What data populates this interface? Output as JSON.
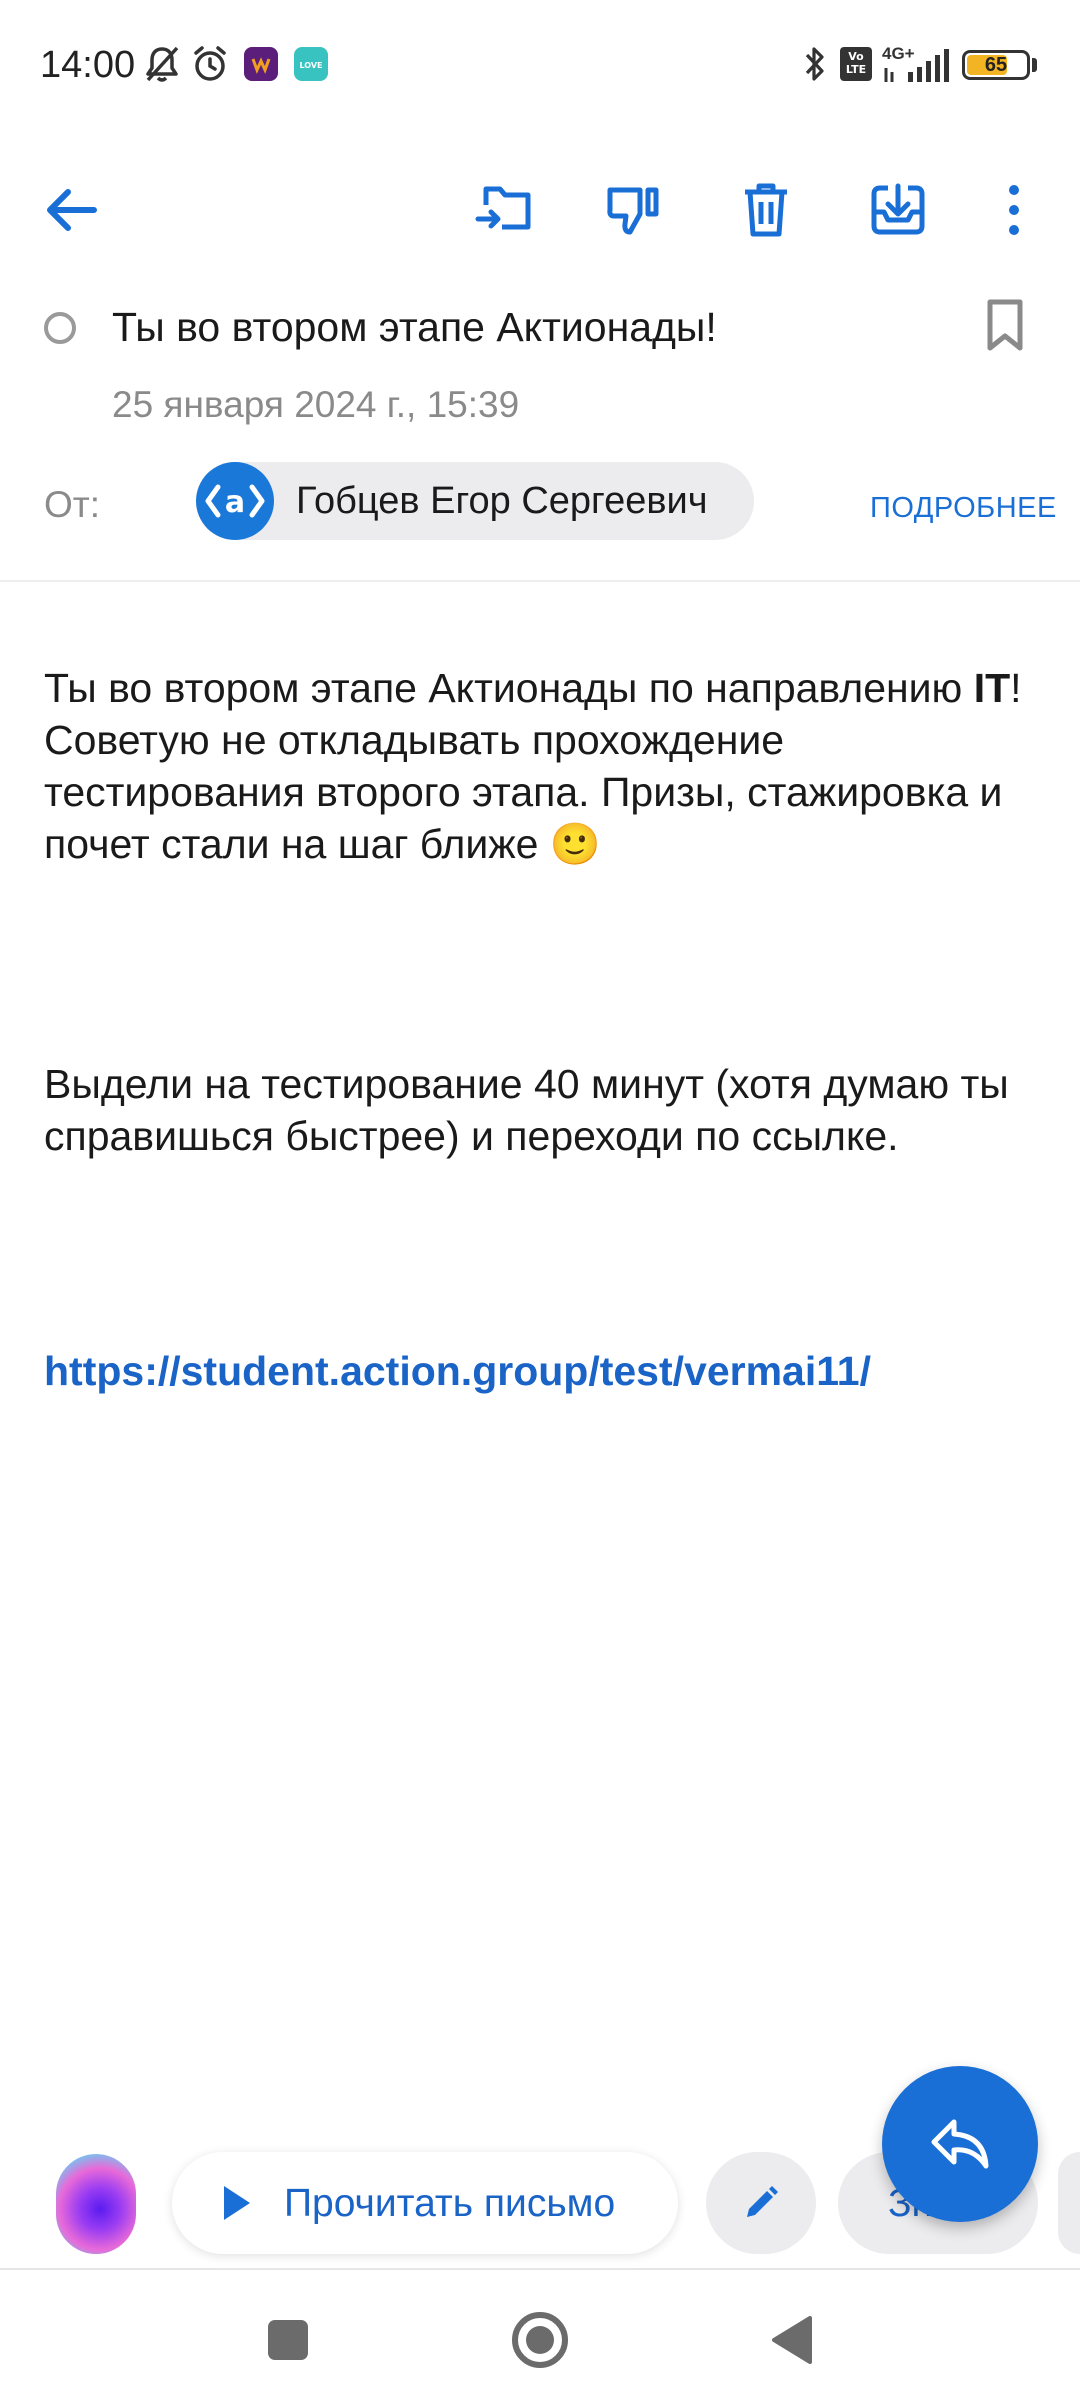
{
  "status_bar": {
    "time": "14:00",
    "battery_level": "65",
    "network_label": "4G+",
    "volte_label": "Vo LTE",
    "icons": [
      "bell-muted-icon",
      "alarm-icon",
      "app-icon-wildberries",
      "app-icon-love",
      "bluetooth-icon",
      "volte-icon",
      "signal-icon",
      "battery-icon"
    ],
    "battery_color": "#f2b422"
  },
  "toolbar": {
    "icons": [
      "back-arrow-icon",
      "move-to-folder-icon",
      "spam-dislike-icon",
      "trash-icon",
      "archive-download-icon",
      "more-vertical-icon"
    ],
    "accent_color": "#1a6fd6"
  },
  "mail": {
    "subject": "Ты во втором этапе Актионады!",
    "date": "25 января 2024 г., 15:39",
    "from_label": "От:",
    "sender_name": "Гобцев Егор Сергеевич",
    "sender_avatar_text": "‹a›",
    "details_label": "ПОДРОБНЕЕ",
    "body": {
      "p1_part1": "Ты во втором этапе Актионады по направлению ",
      "p1_bold": "IT",
      "p1_part2": "! Советую не откладывать прохождение тестирования второго этапа. Призы, стажировка и почет стали на шаг ближе ",
      "p1_emoji": "🙂",
      "p2": "Выдели на тестирование 40 минут (хотя думаю ты справишься быстрее) и переходи по ссылке.",
      "link": "https://student.action.group/test/vermai11/"
    }
  },
  "actions": {
    "read_aloud_label": "Прочитать письмо",
    "partial_chip_label": "Зн"
  },
  "nav": {
    "icons": [
      "recents-square-icon",
      "home-circle-icon",
      "back-triangle-icon"
    ]
  }
}
